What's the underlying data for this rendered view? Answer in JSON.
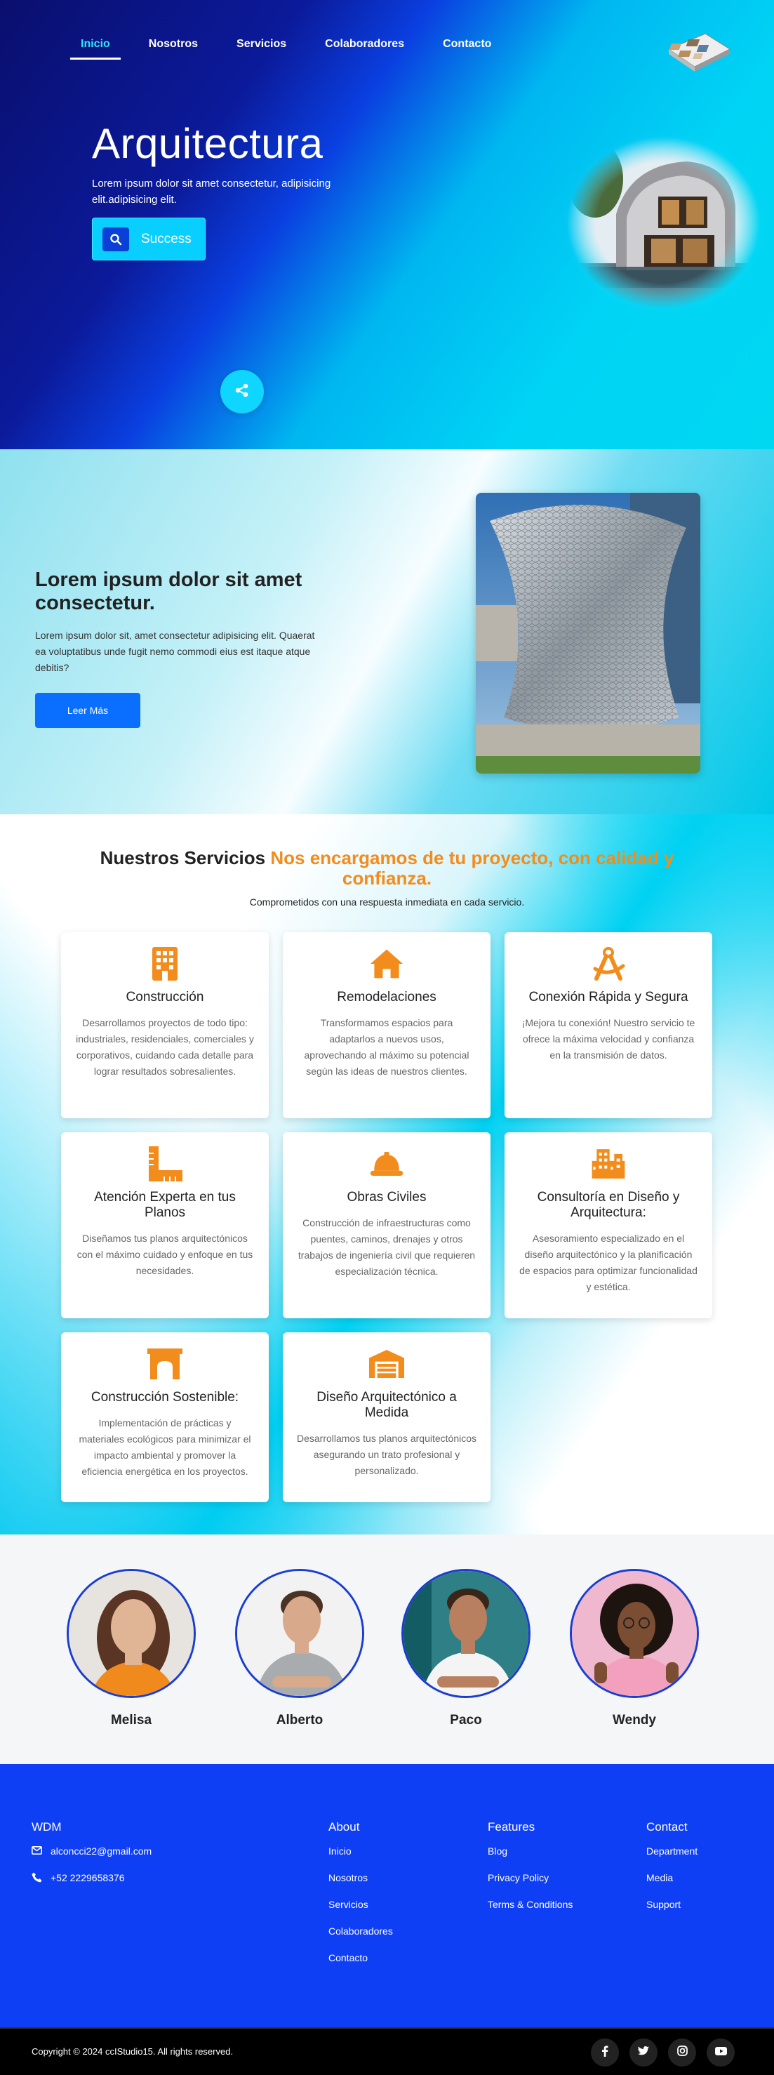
{
  "nav": {
    "items": [
      "Inicio",
      "Nosotros",
      "Servicios",
      "Colaboradores",
      "Contacto"
    ],
    "active": "Inicio"
  },
  "hero": {
    "title": "Arquitectura",
    "subtitle": "Lorem ipsum dolor sit amet consectetur, adipisicing elit.adipisicing elit.",
    "button_label": "Success",
    "button_icon": "search-icon",
    "share_icon": "share-icon"
  },
  "about": {
    "title": "Lorem ipsum dolor sit amet consectetur.",
    "text": "Lorem ipsum dolor sit, amet consectetur adipisicing elit. Quaerat ea voluptatibus unde fugit nemo commodi eius est itaque atque debitis?",
    "button_label": "Leer Más"
  },
  "services": {
    "heading_main": "Nuestros Servicios",
    "heading_highlight": "Nos encargamos de tu proyecto, con calidad y confianza.",
    "subtitle": "Comprometidos con una respuesta inmediata en cada servicio.",
    "accent_color": "#f28c1c",
    "cards": [
      {
        "icon": "building-icon",
        "title": "Construcción",
        "text": "Desarrollamos proyectos de todo tipo: industriales, residenciales, comerciales y corporativos, cuidando cada detalle para lograr resultados sobresalientes."
      },
      {
        "icon": "house-icon",
        "title": "Remodelaciones",
        "text": "Transformamos espacios para adaptarlos a nuevos usos, aprovechando al máximo su potencial según las ideas de nuestros clientes."
      },
      {
        "icon": "compass-drafting-icon",
        "title": "Conexión Rápida y Segura",
        "text": "¡Mejora tu conexión! Nuestro servicio te ofrece la máxima velocidad y confianza en la transmisión de datos."
      },
      {
        "icon": "ruler-combined-icon",
        "title": "Atención Experta en tus Planos",
        "text": "Diseñamos tus planos arquitectónicos con el máximo cuidado y enfoque en tus necesidades."
      },
      {
        "icon": "helmet-safety-icon",
        "title": "Obras Civiles",
        "text": "Construcción de infraestructuras como puentes, caminos, drenajes y otros trabajos de ingeniería civil que requieren especialización técnica."
      },
      {
        "icon": "city-icon",
        "title": "Consultoría en Diseño y Arquitectura:",
        "text": "Asesoramiento especializado en el diseño arquitectónico y la planificación de espacios para optimizar funcionalidad y estética."
      },
      {
        "icon": "archway-icon",
        "title": "Construcción Sostenible:",
        "text": "Implementación de prácticas y materiales ecológicos para minimizar el impacto ambiental y promover la eficiencia energética en los proyectos."
      },
      {
        "icon": "warehouse-icon",
        "title": "Diseño Arquitectónico a Medida",
        "text": "Desarrollamos tus planos arquitectónicos asegurando un trato profesional y personalizado."
      }
    ]
  },
  "team": {
    "members": [
      {
        "name": "Melisa",
        "avatar": "avatar"
      },
      {
        "name": "Alberto",
        "avatar": "avatar"
      },
      {
        "name": "Paco",
        "avatar": "avatar"
      },
      {
        "name": "Wendy",
        "avatar": "avatar"
      }
    ]
  },
  "footer": {
    "brand": "WDM",
    "email": "alconcci22@gmail.com",
    "phone": "+52 2229658376",
    "about_title": "About",
    "about_links": [
      "Inicio",
      "Nosotros",
      "Servicios",
      "Colaboradores",
      "Contacto"
    ],
    "features_title": "Features",
    "features_links": [
      "Blog",
      "Privacy Policy",
      "Terms & Conditions"
    ],
    "contact_title": "Contact",
    "contact_links": [
      "Department",
      "Media",
      "Support"
    ],
    "copyright": "Copyright © 2024 ccIStudio15. All rights reserved.",
    "social": [
      "facebook-icon",
      "twitter-icon",
      "instagram-icon",
      "youtube-icon"
    ],
    "bg_color": "#0f3ff5"
  }
}
